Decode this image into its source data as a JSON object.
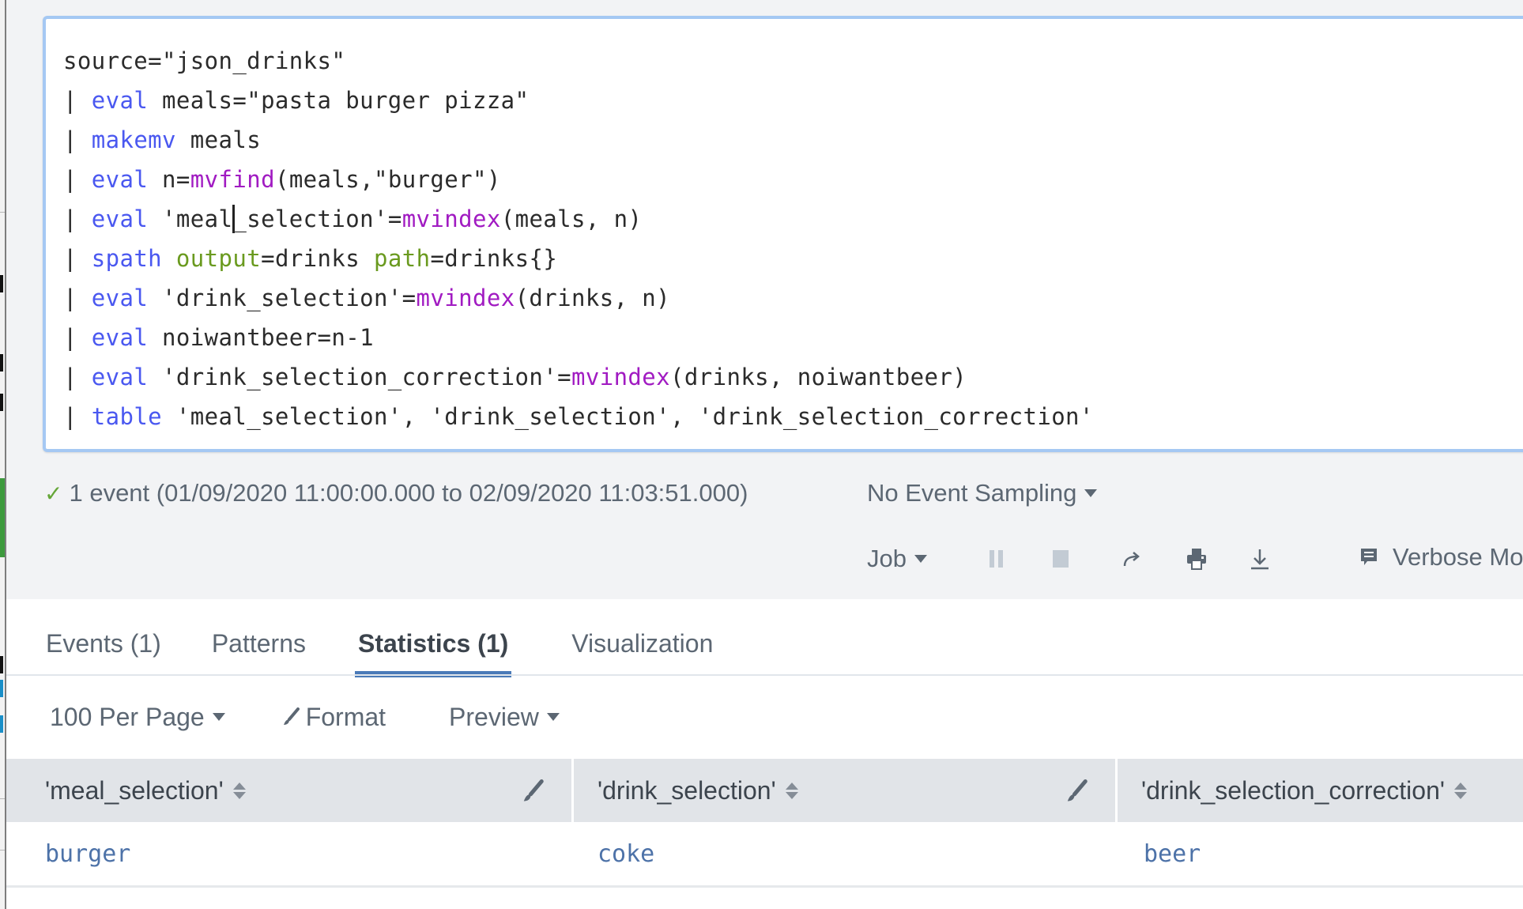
{
  "search": {
    "lines": [
      [
        {
          "t": "source=\"json_drinks\"",
          "c": "plain"
        }
      ],
      [
        {
          "t": "| ",
          "c": "pipe"
        },
        {
          "t": "eval",
          "c": "cmd"
        },
        {
          "t": " meals=\"pasta burger pizza\"",
          "c": "plain"
        }
      ],
      [
        {
          "t": "| ",
          "c": "pipe"
        },
        {
          "t": "makemv",
          "c": "cmd"
        },
        {
          "t": " meals",
          "c": "plain"
        }
      ],
      [
        {
          "t": "| ",
          "c": "pipe"
        },
        {
          "t": "eval",
          "c": "cmd"
        },
        {
          "t": " n=",
          "c": "plain"
        },
        {
          "t": "mvfind",
          "c": "fn"
        },
        {
          "t": "(meals,\"burger\")",
          "c": "plain"
        }
      ],
      [
        {
          "t": "| ",
          "c": "pipe"
        },
        {
          "t": "eval",
          "c": "cmd"
        },
        {
          "t": " 'meal",
          "c": "plain"
        },
        {
          "t": "",
          "c": "caret"
        },
        {
          "t": "_selection'=",
          "c": "plain"
        },
        {
          "t": "mvindex",
          "c": "fn"
        },
        {
          "t": "(meals, n)",
          "c": "plain"
        }
      ],
      [
        {
          "t": "| ",
          "c": "pipe"
        },
        {
          "t": "spath",
          "c": "cmd"
        },
        {
          "t": " ",
          "c": "plain"
        },
        {
          "t": "output",
          "c": "arg"
        },
        {
          "t": "=drinks ",
          "c": "plain"
        },
        {
          "t": "path",
          "c": "arg"
        },
        {
          "t": "=drinks{}",
          "c": "plain"
        }
      ],
      [
        {
          "t": "| ",
          "c": "pipe"
        },
        {
          "t": "eval",
          "c": "cmd"
        },
        {
          "t": " 'drink_selection'=",
          "c": "plain"
        },
        {
          "t": "mvindex",
          "c": "fn"
        },
        {
          "t": "(drinks, n)",
          "c": "plain"
        }
      ],
      [
        {
          "t": "| ",
          "c": "pipe"
        },
        {
          "t": "eval",
          "c": "cmd"
        },
        {
          "t": " noiwantbeer=n-1",
          "c": "plain"
        }
      ],
      [
        {
          "t": "| ",
          "c": "pipe"
        },
        {
          "t": "eval",
          "c": "cmd"
        },
        {
          "t": " 'drink_selection_correction'=",
          "c": "plain"
        },
        {
          "t": "mvindex",
          "c": "fn"
        },
        {
          "t": "(drinks, noiwantbeer)",
          "c": "plain"
        }
      ],
      [
        {
          "t": "| ",
          "c": "pipe"
        },
        {
          "t": "table",
          "c": "cmd"
        },
        {
          "t": " 'meal_selection', 'drink_selection', 'drink_selection_correction'",
          "c": "plain"
        }
      ]
    ]
  },
  "status": {
    "check_icon": "check-icon",
    "text": "1 event (01/09/2020 11:00:00.000 to 02/09/2020 11:03:51.000)",
    "sampling_label": "No Event Sampling"
  },
  "job_toolbar": {
    "job_label": "Job",
    "icons": [
      "pause-icon",
      "stop-icon",
      "share-icon",
      "print-icon",
      "export-icon"
    ],
    "mode_label": "Verbose Mode",
    "mode_icon": "comment-icon"
  },
  "tabs": [
    {
      "label": "Events (1)",
      "active": false
    },
    {
      "label": "Patterns",
      "active": false
    },
    {
      "label": "Statistics (1)",
      "active": true
    },
    {
      "label": "Visualization",
      "active": false
    }
  ],
  "options": {
    "per_page_label": "100 Per Page",
    "format_label": "Format",
    "preview_label": "Preview"
  },
  "table": {
    "columns": [
      "'meal_selection'",
      "'drink_selection'",
      "'drink_selection_correction'"
    ],
    "rows": [
      [
        "burger",
        "coke",
        "beer"
      ]
    ]
  },
  "colors": {
    "accent": "#4a7ab8",
    "search_border": "#a5c8f3",
    "command": "#4a58f0",
    "function": "#a11bc2",
    "argument": "#6a9a1f",
    "cell_value": "#4d72a8",
    "success": "#65a637"
  }
}
